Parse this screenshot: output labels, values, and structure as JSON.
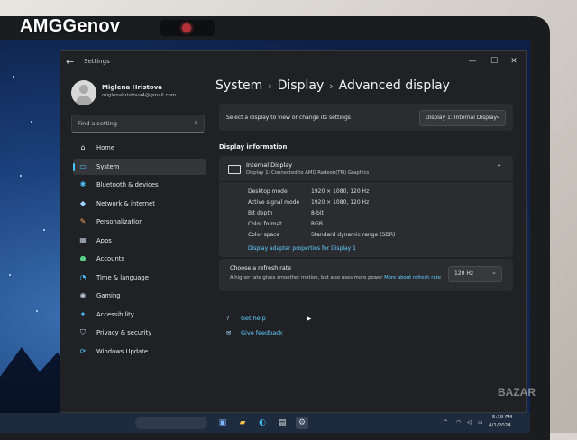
{
  "watermark_top": "AMGGenov",
  "watermark_bottom": "BAZAR",
  "window": {
    "title": "Settings",
    "controls": {
      "minimize": "—",
      "maximize": "☐",
      "close": "✕"
    }
  },
  "profile": {
    "name": "Miglena Hristova",
    "email": "miglenahristova4@gmail.com"
  },
  "search": {
    "placeholder": "Find a setting"
  },
  "nav": [
    {
      "label": "Home",
      "icon": "home-icon",
      "glyph": "⌂",
      "color": "#e8e8e8"
    },
    {
      "label": "System",
      "icon": "monitor-icon",
      "glyph": "▭",
      "color": "#4cc2ff",
      "selected": true
    },
    {
      "label": "Bluetooth & devices",
      "icon": "bluetooth-icon",
      "glyph": "✱",
      "color": "#4cc2ff"
    },
    {
      "label": "Network & internet",
      "icon": "wifi-icon",
      "glyph": "◆",
      "color": "#9ad4ff"
    },
    {
      "label": "Personalization",
      "icon": "brush-icon",
      "glyph": "✎",
      "color": "#f0a45d"
    },
    {
      "label": "Apps",
      "icon": "apps-icon",
      "glyph": "▦",
      "color": "#b9c6d6"
    },
    {
      "label": "Accounts",
      "icon": "person-icon",
      "glyph": "●",
      "color": "#58d08a"
    },
    {
      "label": "Time & language",
      "icon": "globe-clock-icon",
      "glyph": "◔",
      "color": "#4cc2ff"
    },
    {
      "label": "Gaming",
      "icon": "gamepad-icon",
      "glyph": "◉",
      "color": "#b9c6d6"
    },
    {
      "label": "Accessibility",
      "icon": "accessibility-icon",
      "glyph": "✦",
      "color": "#4cc2ff"
    },
    {
      "label": "Privacy & security",
      "icon": "shield-icon",
      "glyph": "⛉",
      "color": "#b9c6d6"
    },
    {
      "label": "Windows Update",
      "icon": "refresh-icon",
      "glyph": "⟳",
      "color": "#4cc2ff"
    }
  ],
  "breadcrumb": [
    "System",
    "Display",
    "Advanced display"
  ],
  "breadcrumb_sep": "›",
  "select_display": {
    "label": "Select a display to view or change its settings",
    "value": "Display 1: Internal Display"
  },
  "display_info": {
    "section_title": "Display information",
    "name": "Internal Display",
    "subtitle": "Display 1: Connected to AMD Radeon(TM) Graphics",
    "properties": [
      {
        "label": "Desktop mode",
        "value": "1920 × 1080, 120 Hz"
      },
      {
        "label": "Active signal mode",
        "value": "1920 × 1080, 120 Hz"
      },
      {
        "label": "Bit depth",
        "value": "8-bit"
      },
      {
        "label": "Color format",
        "value": "RGB"
      },
      {
        "label": "Color space",
        "value": "Standard dynamic range (SDR)"
      }
    ],
    "adapter_link": "Display adapter properties for Display 1"
  },
  "refresh": {
    "title": "Choose a refresh rate",
    "desc": "A higher rate gives smoother motion, but also uses more power",
    "more_link": "More about refresh rate",
    "value": "120 Hz"
  },
  "help_links": [
    {
      "label": "Get help",
      "icon": "help-icon",
      "glyph": "?"
    },
    {
      "label": "Give feedback",
      "icon": "feedback-icon",
      "glyph": "✉"
    }
  ],
  "taskbar": {
    "time": "5:19 PM",
    "date": "4/1/2024"
  },
  "colors": {
    "accent": "#4cc2ff",
    "link": "#60cdff",
    "window_bg": "#202124",
    "card_bg": "#2b2c2f"
  }
}
